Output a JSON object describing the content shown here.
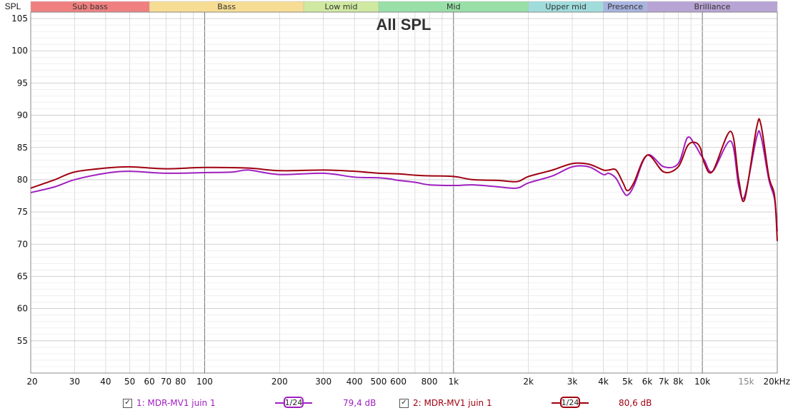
{
  "chart_data": {
    "type": "line",
    "title": "All SPL",
    "ylabel": "SPL",
    "xlim": [
      20,
      20000
    ],
    "ylim": [
      50,
      106
    ],
    "x_scale": "log",
    "grid": true,
    "yticks": [
      55,
      60,
      65,
      70,
      75,
      80,
      85,
      90,
      95,
      100,
      105
    ],
    "xticks": [
      {
        "v": 20,
        "label": "20"
      },
      {
        "v": 30,
        "label": "30"
      },
      {
        "v": 40,
        "label": "40"
      },
      {
        "v": 50,
        "label": "50"
      },
      {
        "v": 60,
        "label": "60"
      },
      {
        "v": 70,
        "label": "70"
      },
      {
        "v": 80,
        "label": "80"
      },
      {
        "v": 100,
        "label": "100"
      },
      {
        "v": 200,
        "label": "200"
      },
      {
        "v": 300,
        "label": "300"
      },
      {
        "v": 400,
        "label": "400"
      },
      {
        "v": 500,
        "label": "500"
      },
      {
        "v": 600,
        "label": "600"
      },
      {
        "v": 800,
        "label": "800"
      },
      {
        "v": 1000,
        "label": "1k"
      },
      {
        "v": 2000,
        "label": "2k"
      },
      {
        "v": 3000,
        "label": "3k"
      },
      {
        "v": 4000,
        "label": "4k"
      },
      {
        "v": 5000,
        "label": "5k"
      },
      {
        "v": 6000,
        "label": "6k"
      },
      {
        "v": 7000,
        "label": "7k"
      },
      {
        "v": 8000,
        "label": "8k"
      },
      {
        "v": 10000,
        "label": "10k"
      },
      {
        "v": 15000,
        "label": "15k"
      },
      {
        "v": 20000,
        "label": "20kHz"
      }
    ],
    "bands": [
      {
        "label": "Sub bass",
        "from": 20,
        "to": 60,
        "color": "#f08080"
      },
      {
        "label": "Bass",
        "from": 60,
        "to": 250,
        "color": "#f7dd94"
      },
      {
        "label": "Low mid",
        "from": 250,
        "to": 500,
        "color": "#cfe9a0"
      },
      {
        "label": "Mid",
        "from": 500,
        "to": 2000,
        "color": "#98e0a8"
      },
      {
        "label": "Upper mid",
        "from": 2000,
        "to": 4000,
        "color": "#a0dcdc"
      },
      {
        "label": "Presence",
        "from": 4000,
        "to": 6000,
        "color": "#a8b4e0"
      },
      {
        "label": "Brilliance",
        "from": 6000,
        "to": 20000,
        "color": "#b8a4d4"
      }
    ],
    "series": [
      {
        "name": "1: MDR-MV1 juin 1",
        "color": "#a020c0",
        "smoothing": "1/24",
        "level": "79,4 dB",
        "points": [
          [
            20,
            78
          ],
          [
            25,
            78.9
          ],
          [
            30,
            80
          ],
          [
            40,
            81
          ],
          [
            50,
            81.3
          ],
          [
            70,
            81
          ],
          [
            100,
            81.1
          ],
          [
            130,
            81.2
          ],
          [
            150,
            81.5
          ],
          [
            200,
            80.8
          ],
          [
            300,
            81
          ],
          [
            400,
            80.4
          ],
          [
            500,
            80.3
          ],
          [
            560,
            80.1
          ],
          [
            600,
            79.9
          ],
          [
            700,
            79.6
          ],
          [
            800,
            79.2
          ],
          [
            1000,
            79.1
          ],
          [
            1200,
            79.2
          ],
          [
            1500,
            78.9
          ],
          [
            1800,
            78.7
          ],
          [
            2000,
            79.5
          ],
          [
            2500,
            80.6
          ],
          [
            3000,
            82
          ],
          [
            3500,
            82
          ],
          [
            4000,
            80.8
          ],
          [
            4200,
            81
          ],
          [
            4500,
            80.2
          ],
          [
            4800,
            78.2
          ],
          [
            5000,
            77.6
          ],
          [
            5300,
            79
          ],
          [
            6000,
            83.8
          ],
          [
            7000,
            82
          ],
          [
            8000,
            82.5
          ],
          [
            8700,
            86.5
          ],
          [
            9300,
            85.5
          ],
          [
            9800,
            84
          ],
          [
            10200,
            83
          ],
          [
            11000,
            81.3
          ],
          [
            13000,
            86
          ],
          [
            14000,
            79
          ],
          [
            14800,
            77.5
          ],
          [
            16500,
            86.5
          ],
          [
            17200,
            86.7
          ],
          [
            18500,
            80
          ],
          [
            19500,
            77
          ],
          [
            20000,
            72
          ]
        ]
      },
      {
        "name": "2: MDR-MV1 juin 1",
        "color": "#a00010",
        "smoothing": "1/24",
        "level": "80,6 dB",
        "points": [
          [
            20,
            78.7
          ],
          [
            25,
            80
          ],
          [
            30,
            81.2
          ],
          [
            40,
            81.8
          ],
          [
            50,
            82
          ],
          [
            70,
            81.7
          ],
          [
            100,
            81.9
          ],
          [
            150,
            81.8
          ],
          [
            200,
            81.4
          ],
          [
            300,
            81.5
          ],
          [
            400,
            81.3
          ],
          [
            500,
            81
          ],
          [
            600,
            80.9
          ],
          [
            700,
            80.7
          ],
          [
            800,
            80.6
          ],
          [
            1000,
            80.5
          ],
          [
            1200,
            80
          ],
          [
            1500,
            79.9
          ],
          [
            1800,
            79.7
          ],
          [
            2000,
            80.5
          ],
          [
            2500,
            81.5
          ],
          [
            3000,
            82.5
          ],
          [
            3500,
            82.4
          ],
          [
            4000,
            81.5
          ],
          [
            4200,
            81.5
          ],
          [
            4500,
            81.5
          ],
          [
            4800,
            79.5
          ],
          [
            5000,
            78.3
          ],
          [
            5300,
            79.5
          ],
          [
            6000,
            83.8
          ],
          [
            7000,
            81.2
          ],
          [
            8000,
            82
          ],
          [
            8700,
            85.2
          ],
          [
            9300,
            85.8
          ],
          [
            9800,
            85
          ],
          [
            10200,
            82.5
          ],
          [
            11000,
            81.3
          ],
          [
            13000,
            87.5
          ],
          [
            14000,
            80
          ],
          [
            14800,
            77
          ],
          [
            16500,
            88
          ],
          [
            17200,
            88.5
          ],
          [
            18500,
            80.5
          ],
          [
            19500,
            77.5
          ],
          [
            20000,
            70.5
          ]
        ]
      }
    ]
  }
}
